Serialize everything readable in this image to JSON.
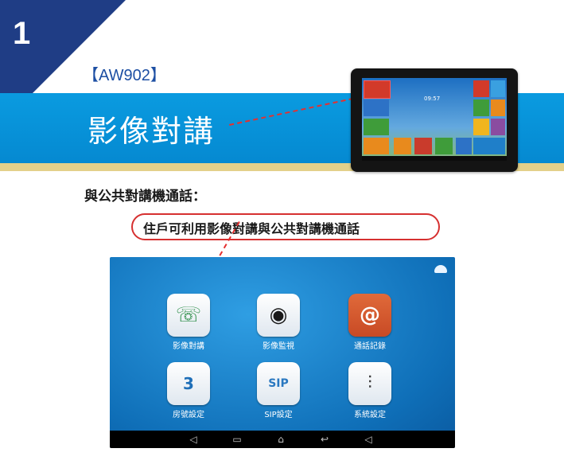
{
  "slide": {
    "number": "1",
    "model": "【AW902】",
    "banner_title": "影像對講",
    "section_title": "與公共對講機通話：",
    "callout": "住戶可利用影像對講與公共對講機通話"
  },
  "tablet": {
    "clock": "09:57"
  },
  "device": {
    "apps": [
      {
        "label": "影像對講",
        "icon": "phone-handset-icon"
      },
      {
        "label": "影像監視",
        "icon": "camera-lens-icon"
      },
      {
        "label": "通話記錄",
        "icon": "address-book-icon"
      },
      {
        "label": "房號設定",
        "icon": "house-icon"
      },
      {
        "label": "SIP設定",
        "icon": "sip-icon"
      },
      {
        "label": "系統設定",
        "icon": "sliders-icon"
      }
    ],
    "sip_badge": "SIP",
    "house_badge": "3",
    "mail_badge": "@"
  },
  "colors": {
    "corner": "#1f3d85",
    "band": "#0a9be0",
    "accent_red": "#d63030"
  }
}
